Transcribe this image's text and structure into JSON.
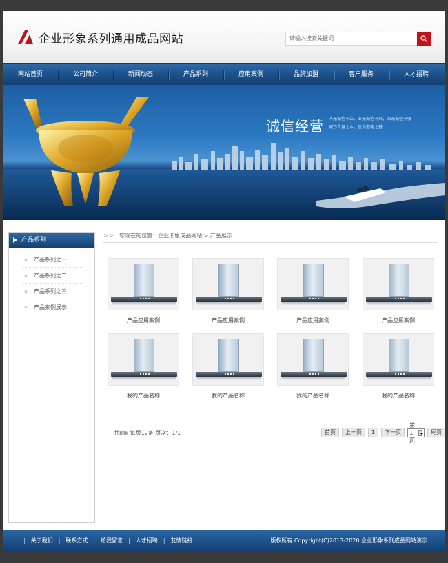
{
  "site": {
    "title": "企业形象系列通用成品网站",
    "search_placeholder": "请输入搜索关键词"
  },
  "nav": {
    "items": [
      {
        "label": "网站首页"
      },
      {
        "label": "公司简介"
      },
      {
        "label": "新闻动态"
      },
      {
        "label": "产品系列"
      },
      {
        "label": "应用案例"
      },
      {
        "label": "品牌加盟"
      },
      {
        "label": "客户服务"
      },
      {
        "label": "人才招聘"
      }
    ]
  },
  "banner": {
    "slogan": "诚信经营",
    "sub_line1": "人无诚信不立，业无诚信不兴，国无诚信不强",
    "sub_line2": "诚乃立身之本，信为道德之基"
  },
  "sidebar": {
    "heading": "产品系列",
    "items": [
      {
        "label": "产品系列之一"
      },
      {
        "label": "产品系列之二"
      },
      {
        "label": "产品系列之三"
      },
      {
        "label": "产品案例展示"
      }
    ]
  },
  "breadcrumb": {
    "arrow": ">>",
    "prefix": "您现在的位置：",
    "home": "企业形象成品网站",
    "sep": " > ",
    "current": "产品展示"
  },
  "products": [
    {
      "caption": "产品应用案例"
    },
    {
      "caption": "产品应用案例"
    },
    {
      "caption": "产品应用案例"
    },
    {
      "caption": "产品应用案例"
    },
    {
      "caption": "我的产品名称"
    },
    {
      "caption": "我的产品名称"
    },
    {
      "caption": "我的产品名称"
    },
    {
      "caption": "我的产品名称"
    }
  ],
  "pager": {
    "info": "共8条 每页12条 页次：1/1",
    "first": "首页",
    "prev": "上一页",
    "current": "1",
    "next": "下一页",
    "select": "第1页",
    "last": "尾页"
  },
  "footer": {
    "links": [
      {
        "label": "关于我们"
      },
      {
        "label": "联系方式"
      },
      {
        "label": "给我留言"
      },
      {
        "label": "人才招聘"
      },
      {
        "label": "友情链接"
      }
    ],
    "copyright": "版权所有  Copyright(C)2013-2020 企业形象系列成品网站演示"
  },
  "colors": {
    "nav_blue": "#1b4f88",
    "accent_red": "#c4121a",
    "background": "#3a3a3a"
  }
}
